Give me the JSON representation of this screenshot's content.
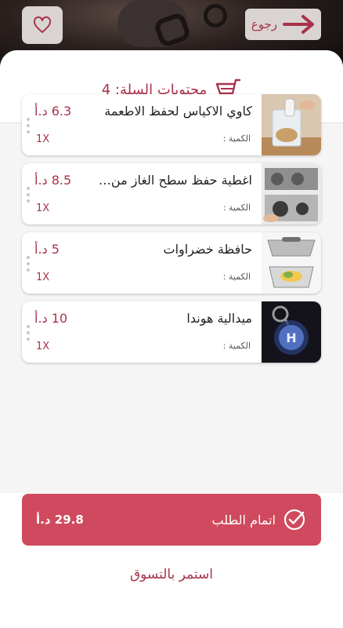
{
  "header": {
    "back_label": "رجوع",
    "cart_title": "محتويات السلة: 4"
  },
  "colors": {
    "accent": "#a8324a",
    "button": "#cf4a5e",
    "sheet": "#f5f5f5"
  },
  "cart": {
    "qty_label": "الكمية :",
    "items": [
      {
        "name": "كاوي الاكياس لحفظ الاطعمة",
        "price": "6.3 د.أ",
        "qty": "1X"
      },
      {
        "name": "اغطية حفظ سطح الغاز من الاتساخ",
        "price": "8.5 د.أ",
        "qty": "1X"
      },
      {
        "name": "حافظة خضراوات",
        "price": "5 د.أ",
        "qty": "1X"
      },
      {
        "name": "ميدالية هوندا",
        "price": "10 د.أ",
        "qty": "1X"
      }
    ]
  },
  "checkout": {
    "label": "اتمام الطلب",
    "total": "29.8 د.أ"
  },
  "continue_label": "استمر بالتسوق"
}
